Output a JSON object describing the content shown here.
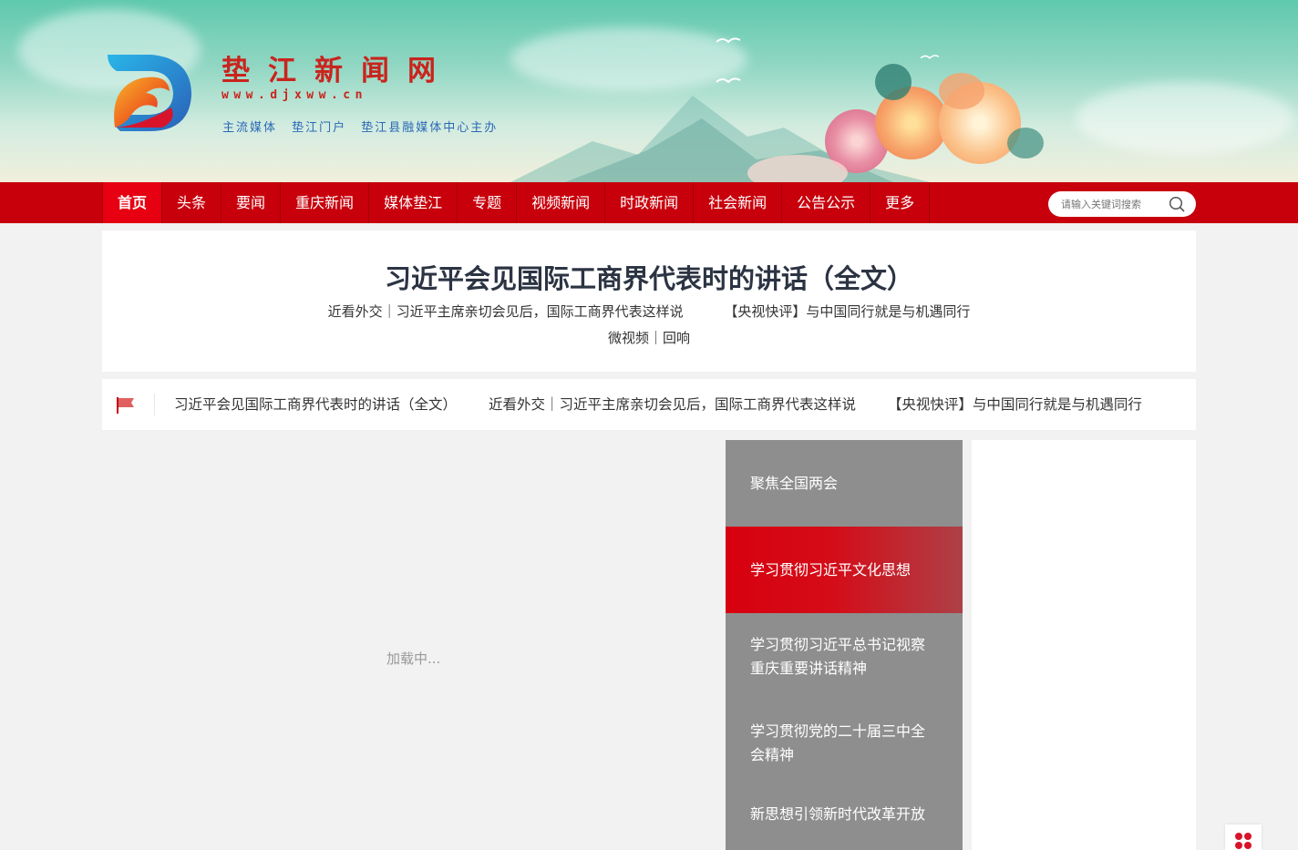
{
  "site": {
    "title": "垫江新闻网",
    "url": "www.djxww.cn",
    "slogan": "主流媒体 垫江门户 垫江县融媒体中心主办"
  },
  "nav": {
    "items": [
      "首页",
      "头条",
      "要闻",
      "重庆新闻",
      "媒体垫江",
      "专题",
      "视频新闻",
      "时政新闻",
      "社会新闻",
      "公告公示",
      "更多"
    ],
    "active_index": 0
  },
  "search": {
    "placeholder": "请输入关键词搜索"
  },
  "headline": {
    "title": "习近平会见国际工商界代表时的讲话（全文）",
    "links": [
      "近看外交｜习近平主席亲切会见后，国际工商界代表这样说",
      "【央视快评】与中国同行就是与机遇同行"
    ],
    "extra": "微视频｜回响"
  },
  "ticker": {
    "items": [
      "习近平会见国际工商界代表时的讲话（全文）",
      "近看外交｜习近平主席亲切会见后，国际工商界代表这样说",
      "【央视快评】与中国同行就是与机遇同行"
    ]
  },
  "slider": {
    "loading_text": "加载中..."
  },
  "topics": [
    {
      "label": "聚焦全国两会",
      "active": false
    },
    {
      "label": "学习贯彻习近平文化思想",
      "active": true
    },
    {
      "label": "学习贯彻习近平总书记视察重庆重要讲话精神",
      "active": false
    },
    {
      "label": "学习贯彻党的二十届三中全会精神",
      "active": false
    },
    {
      "label": "新思想引领新时代改革开放",
      "active": false
    }
  ],
  "colors": {
    "brand_red": "#c8000c",
    "active_red": "#e60012",
    "title_red": "#c9241d",
    "slogan_blue": "#2a68b5"
  }
}
